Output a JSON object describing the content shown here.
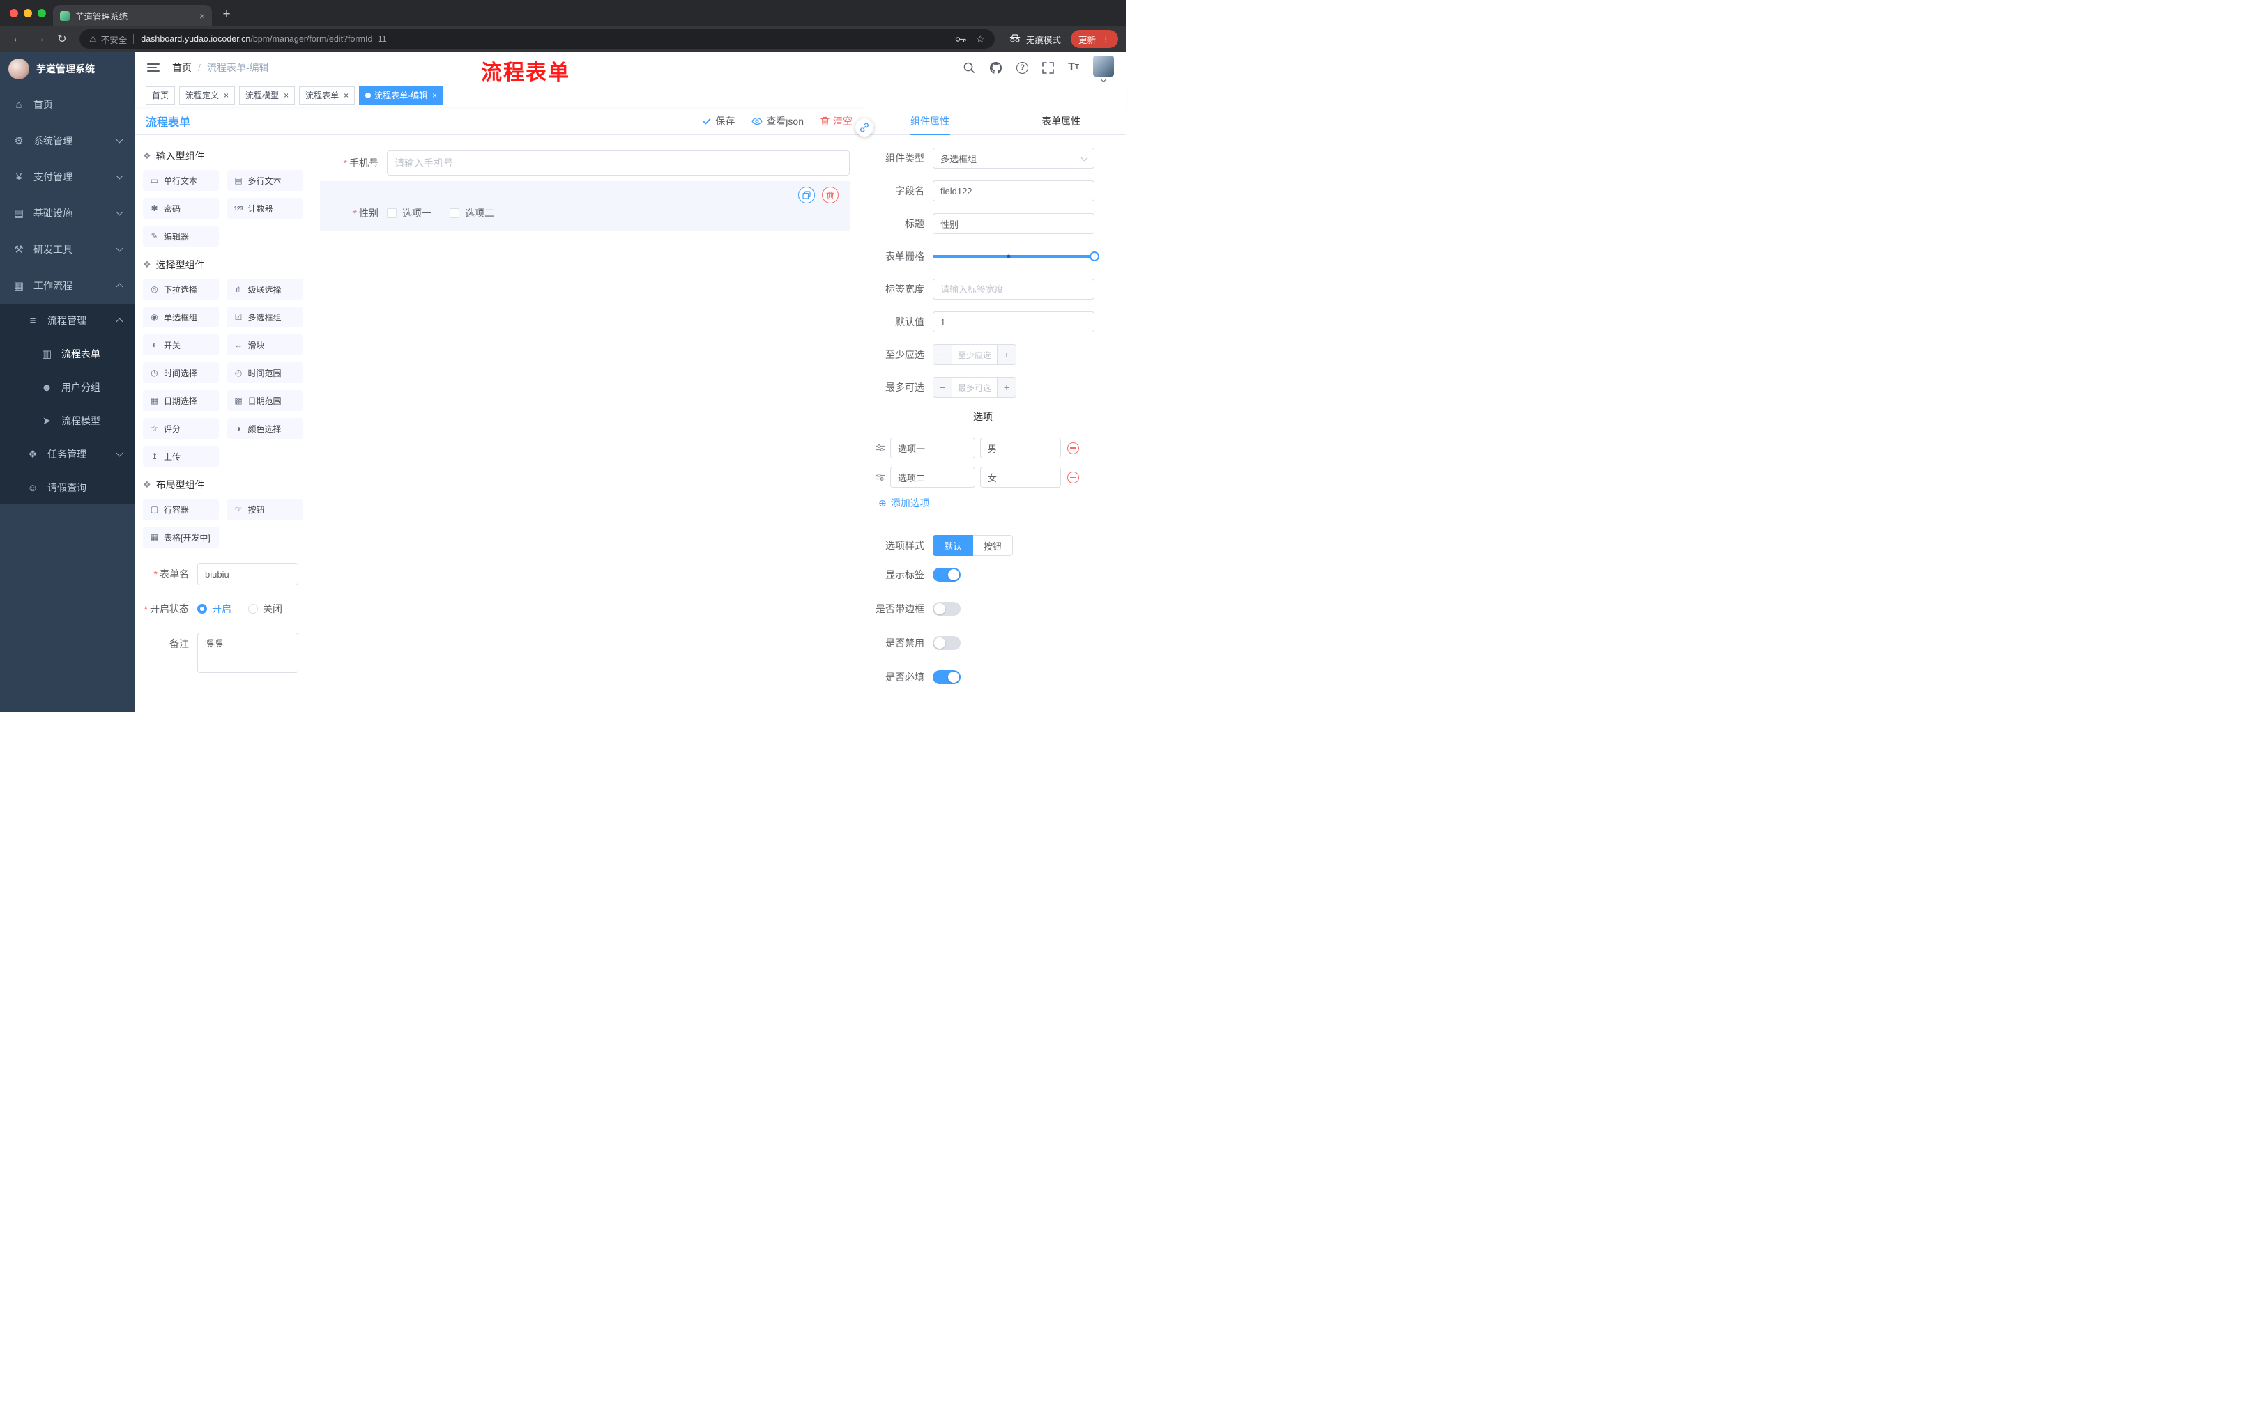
{
  "colors": {
    "accent": "#409eff",
    "danger": "#f56c6c",
    "update_red": "#d6453a",
    "sidebar_bg": "#304156",
    "sidebar_sub_bg": "#1f2d3d"
  },
  "icons": {
    "close": "×",
    "plus": "+",
    "back": "←",
    "forward": "→",
    "reload": "↻",
    "warning": "⚠",
    "menu_dots": "⋮",
    "star": "☆",
    "help": "?",
    "group": "❖",
    "add_circle": "⊕",
    "required": "*",
    "font_large": "T",
    "font_small": "T"
  },
  "browser": {
    "tab_title": "芋道管理系统",
    "security_label": "不安全",
    "url_host": "dashboard.yudao.iocoder.cn",
    "url_path": "/bpm/manager/form/edit?formId=11",
    "incognito_label": "无痕模式",
    "update_label": "更新"
  },
  "sidebar": {
    "app_title": "芋道管理系统",
    "items": [
      {
        "icon": "⌂",
        "label": "首页"
      },
      {
        "icon": "⚙",
        "label": "系统管理",
        "arrow": "down"
      },
      {
        "icon": "¥",
        "label": "支付管理",
        "arrow": "down"
      },
      {
        "icon": "▤",
        "label": "基础设施",
        "arrow": "down"
      },
      {
        "icon": "⚒",
        "label": "研发工具",
        "arrow": "down"
      },
      {
        "icon": "▦",
        "label": "工作流程",
        "arrow": "up"
      },
      {
        "icon": "≡",
        "label": "流程管理",
        "arrow": "up"
      },
      {
        "icon": "▥",
        "label": "流程表单",
        "active": true
      },
      {
        "icon": "☻",
        "label": "用户分组"
      },
      {
        "icon": "➤",
        "label": "流程模型"
      },
      {
        "icon": "❖",
        "label": "任务管理",
        "arrow": "down"
      },
      {
        "icon": "☺",
        "label": "请假查询"
      }
    ]
  },
  "header": {
    "breadcrumb": {
      "home": "首页",
      "sep": "/",
      "current": "流程表单-编辑"
    },
    "annotation": "流程表单"
  },
  "tags": {
    "items": [
      {
        "label": "首页",
        "closable": false,
        "active": false
      },
      {
        "label": "流程定义",
        "closable": true,
        "active": false
      },
      {
        "label": "流程模型",
        "closable": true,
        "active": false
      },
      {
        "label": "流程表单",
        "closable": true,
        "active": false
      },
      {
        "label": "流程表单-编辑",
        "closable": true,
        "active": true
      }
    ]
  },
  "designer": {
    "title": "流程表单",
    "actions": {
      "save": "保存",
      "view_json": "查看json",
      "clear": "清空"
    },
    "groups": [
      {
        "title": "输入型组件",
        "items": [
          {
            "icon": "▭",
            "label": "单行文本"
          },
          {
            "icon": "▤",
            "label": "多行文本"
          },
          {
            "icon": "✱",
            "label": "密码"
          },
          {
            "icon": "123",
            "label": "计数器"
          },
          {
            "icon": "✎",
            "label": "编辑器"
          }
        ]
      },
      {
        "title": "选择型组件",
        "items": [
          {
            "icon": "◎",
            "label": "下拉选择"
          },
          {
            "icon": "⋔",
            "label": "级联选择"
          },
          {
            "icon": "◉",
            "label": "单选框组"
          },
          {
            "icon": "☑",
            "label": "多选框组"
          },
          {
            "icon": "◐",
            "label": "开关"
          },
          {
            "icon": "↔",
            "label": "滑块"
          },
          {
            "icon": "◷",
            "label": "时间选择"
          },
          {
            "icon": "◴",
            "label": "时间范围"
          },
          {
            "icon": "▦",
            "label": "日期选择"
          },
          {
            "icon": "▩",
            "label": "日期范围"
          },
          {
            "icon": "☆",
            "label": "评分"
          },
          {
            "icon": "◑",
            "label": "颜色选择"
          },
          {
            "icon": "↥",
            "label": "上传"
          }
        ]
      },
      {
        "title": "布局型组件",
        "items": [
          {
            "icon": "▢",
            "label": "行容器"
          },
          {
            "icon": "☞",
            "label": "按钮"
          },
          {
            "icon": "▦",
            "label": "表格[开发中]"
          }
        ]
      }
    ],
    "panel_form": {
      "name_label": "表单名",
      "name_value": "biubiu",
      "status_label": "开启状态",
      "status_options": [
        {
          "label": "开启",
          "selected": true
        },
        {
          "label": "关闭",
          "selected": false
        }
      ],
      "remark_label": "备注",
      "remark_value": "嘿嘿"
    },
    "canvas": {
      "phone_label": "手机号",
      "phone_placeholder": "请输入手机号",
      "gender_label": "性别",
      "gender_options": [
        {
          "label": "选项一",
          "checked": false
        },
        {
          "label": "选项二",
          "checked": false
        }
      ]
    }
  },
  "props": {
    "tabs": [
      {
        "label": "组件属性",
        "active": true
      },
      {
        "label": "表单属性",
        "active": false
      }
    ],
    "component_type": {
      "label": "组件类型",
      "value": "多选框组"
    },
    "field_name": {
      "label": "字段名",
      "value": "field122"
    },
    "title_row": {
      "label": "标题",
      "value": "性别"
    },
    "grid": {
      "label": "表单栅格",
      "value": 24,
      "max": 24
    },
    "label_width": {
      "label": "标签宽度",
      "placeholder": "请输入标签宽度"
    },
    "default_value": {
      "label": "默认值",
      "value": "1"
    },
    "min_select": {
      "label": "至少应选",
      "placeholder": "至少应选",
      "minus": "−",
      "plus": "+"
    },
    "max_select": {
      "label": "最多可选",
      "placeholder": "最多可选",
      "minus": "−",
      "plus": "+"
    },
    "options_divider": "选项",
    "options": [
      {
        "name": "选项一",
        "value": "男"
      },
      {
        "name": "选项二",
        "value": "女"
      }
    ],
    "add_option": "添加选项",
    "option_style": {
      "label": "选项样式",
      "buttons": [
        {
          "label": "默认",
          "active": true
        },
        {
          "label": "按钮",
          "active": false
        }
      ]
    },
    "switches": [
      {
        "label": "显示标签",
        "state": "on"
      },
      {
        "label": "是否带边框",
        "state": "off"
      },
      {
        "label": "是否禁用",
        "state": "off"
      },
      {
        "label": "是否必填",
        "state": "on"
      }
    ]
  }
}
